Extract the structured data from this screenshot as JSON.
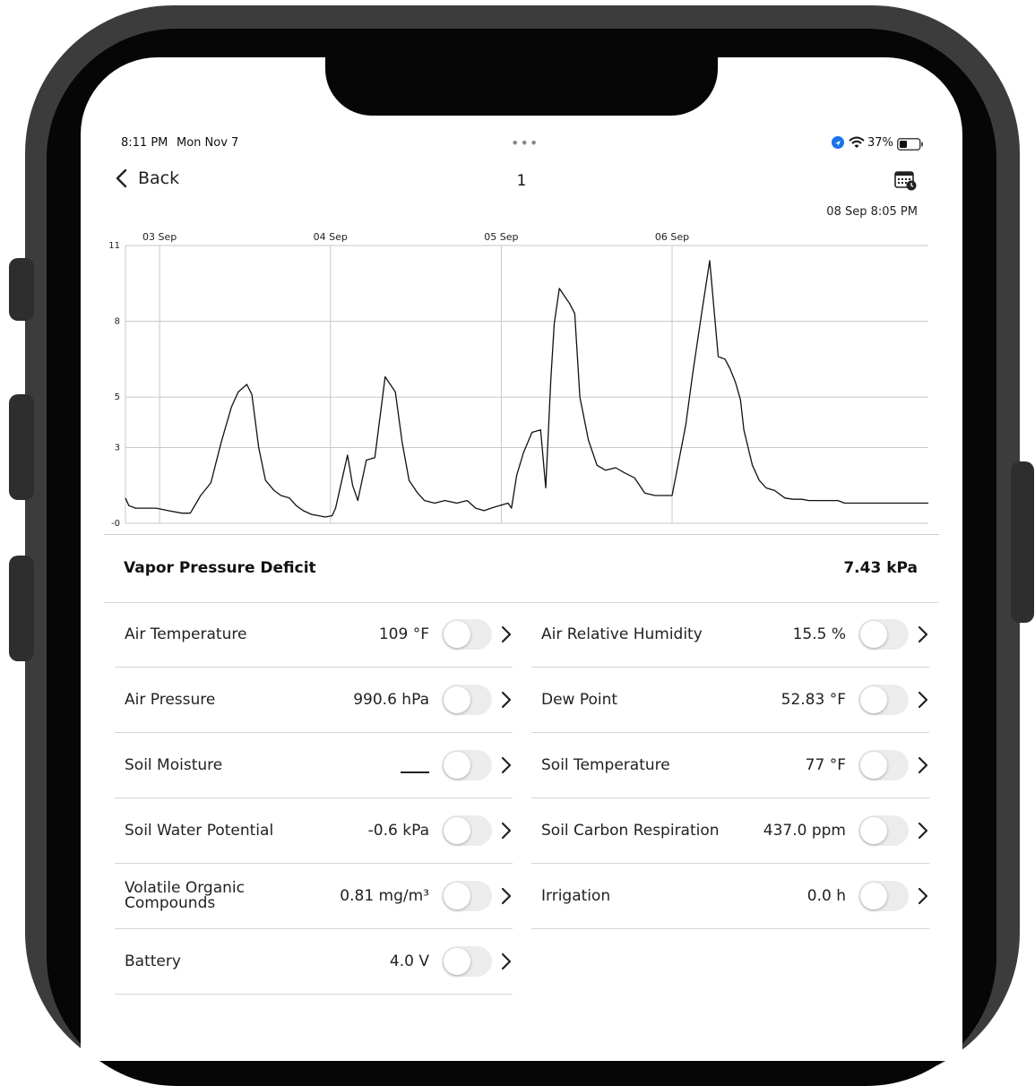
{
  "status_bar": {
    "time": "8:11 PM",
    "date": "Mon Nov 7",
    "battery": "37%",
    "location_icon": "location-arrow-icon",
    "wifi_icon": "wifi-icon",
    "battery_icon": "battery-icon"
  },
  "nav": {
    "back_label": "Back",
    "title": "1",
    "calendar_icon": "calendar-icon"
  },
  "chart_timestamp": "08 Sep 8:05 PM",
  "chart_data": {
    "type": "line",
    "x_tick_labels": [
      "03 Sep",
      "04 Sep",
      "05 Sep",
      "06 Sep"
    ],
    "y_tick_labels": [
      "11",
      "8",
      "5",
      "3",
      "-0"
    ],
    "y_ticks": [
      11,
      8,
      5,
      3,
      0
    ],
    "ylim": [
      0,
      11
    ],
    "xlim": [
      0,
      4.7
    ],
    "grid": true,
    "series": [
      {
        "color": "#111111",
        "x": [
          0.0,
          0.02,
          0.06,
          0.12,
          0.18,
          0.25,
          0.33,
          0.38,
          0.44,
          0.5,
          0.56,
          0.62,
          0.66,
          0.71,
          0.74,
          0.78,
          0.82,
          0.87,
          0.91,
          0.96,
          1.0,
          1.04,
          1.09,
          1.13,
          1.17,
          1.21,
          1.23,
          1.26,
          1.3,
          1.33,
          1.36,
          1.41,
          1.46,
          1.52,
          1.58,
          1.62,
          1.66,
          1.71,
          1.75,
          1.81,
          1.87,
          1.94,
          2.0,
          2.05,
          2.1,
          2.14,
          2.19,
          2.24,
          2.26,
          2.29,
          2.33,
          2.38,
          2.43,
          2.46,
          2.49,
          2.51,
          2.54,
          2.57,
          2.6,
          2.63,
          2.66,
          2.71,
          2.76,
          2.81,
          2.87,
          2.92,
          2.98,
          3.04,
          3.1,
          3.16,
          3.2,
          3.24,
          3.28,
          3.32,
          3.37,
          3.42,
          3.47,
          3.51,
          3.54,
          3.57,
          3.6,
          3.62,
          3.67,
          3.71,
          3.75,
          3.8,
          3.86,
          3.91,
          3.96,
          4.0,
          4.04,
          4.08,
          4.12,
          4.17,
          4.21,
          4.24,
          4.28,
          4.32,
          4.36,
          4.4,
          4.45,
          4.51,
          4.58,
          4.65,
          4.7
        ],
        "y": [
          1.0,
          0.7,
          0.6,
          0.6,
          0.6,
          0.5,
          0.4,
          0.4,
          1.1,
          1.6,
          3.2,
          4.6,
          5.2,
          5.5,
          5.1,
          3.0,
          1.7,
          1.3,
          1.1,
          1.0,
          0.7,
          0.5,
          0.35,
          0.3,
          0.25,
          0.3,
          0.6,
          1.5,
          2.7,
          1.5,
          0.9,
          2.5,
          2.6,
          5.8,
          5.2,
          3.2,
          1.7,
          1.2,
          0.9,
          0.8,
          0.9,
          0.8,
          0.9,
          0.6,
          0.5,
          0.6,
          0.7,
          0.8,
          0.6,
          1.9,
          2.8,
          3.6,
          3.7,
          1.4,
          5.7,
          7.9,
          9.3,
          9.0,
          8.7,
          8.3,
          5.0,
          3.3,
          2.3,
          2.1,
          2.2,
          2.0,
          1.8,
          1.2,
          1.1,
          1.1,
          1.1,
          2.5,
          3.9,
          5.9,
          8.2,
          10.4,
          6.6,
          6.5,
          6.1,
          5.6,
          4.9,
          3.7,
          2.3,
          1.7,
          1.4,
          1.3,
          1.0,
          0.95,
          0.95,
          0.9,
          0.9,
          0.9,
          0.9,
          0.9,
          0.8,
          0.8,
          0.8,
          0.8,
          0.8,
          0.8,
          0.8,
          0.8,
          0.8,
          0.8,
          0.8
        ]
      }
    ]
  },
  "headline": {
    "label": "Vapor Pressure Deficit",
    "value": "7.43 kPa"
  },
  "left_column": [
    {
      "label": "Air Temperature",
      "value": "109 °F",
      "enabled": false
    },
    {
      "label": "Air Pressure",
      "value": "990.6 hPa",
      "enabled": false
    },
    {
      "label": "Soil Moisture",
      "value": "",
      "enabled": false
    },
    {
      "label": "Soil Water Potential",
      "value": "-0.6 kPa",
      "enabled": false
    },
    {
      "label": "Volatile Organic Compounds",
      "value": "0.81 mg/m³",
      "enabled": false
    },
    {
      "label": "Battery",
      "value": "4.0 V",
      "enabled": false
    }
  ],
  "right_column": [
    {
      "label": "Air Relative Humidity",
      "value": "15.5 %",
      "enabled": false
    },
    {
      "label": "Dew Point",
      "value": "52.83 °F",
      "enabled": false
    },
    {
      "label": "Soil Temperature",
      "value": "77 °F",
      "enabled": false
    },
    {
      "label": "Soil Carbon Respiration",
      "value": "437.0 ppm",
      "enabled": false
    },
    {
      "label": "Irrigation",
      "value": "0.0 h",
      "enabled": false
    }
  ]
}
